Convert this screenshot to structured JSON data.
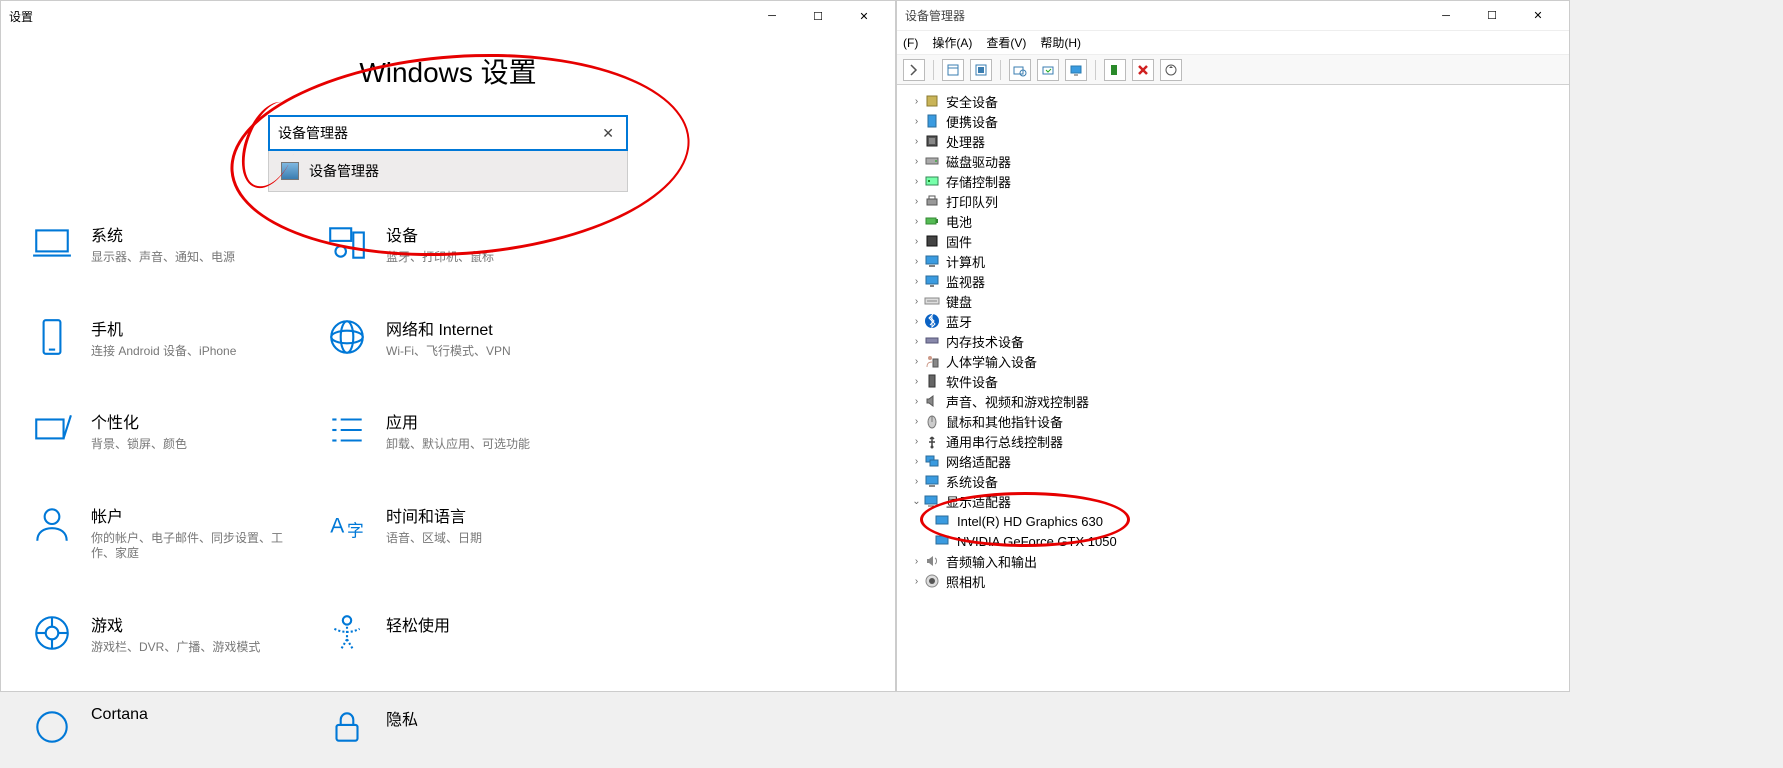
{
  "settings": {
    "window_title": "设置",
    "heading": "Windows 设置",
    "search_value": "设备管理器",
    "suggestion": "设备管理器",
    "categories": [
      {
        "title": "系统",
        "desc": "显示器、声音、通知、电源"
      },
      {
        "title": "设备",
        "desc": "蓝牙、打印机、鼠标"
      },
      {
        "title": "手机",
        "desc": "连接 Android 设备、iPhone"
      },
      {
        "title": "网络和 Internet",
        "desc": "Wi-Fi、飞行模式、VPN"
      },
      {
        "title": "个性化",
        "desc": "背景、锁屏、颜色"
      },
      {
        "title": "应用",
        "desc": "卸载、默认应用、可选功能"
      },
      {
        "title": "帐户",
        "desc": "你的帐户、电子邮件、同步设置、工作、家庭"
      },
      {
        "title": "时间和语言",
        "desc": "语音、区域、日期"
      },
      {
        "title": "游戏",
        "desc": "游戏栏、DVR、广播、游戏模式"
      },
      {
        "title": "轻松使用",
        "desc": ""
      },
      {
        "title": "Cortana",
        "desc": ""
      },
      {
        "title": "隐私",
        "desc": ""
      }
    ]
  },
  "device_manager": {
    "window_title": "设备管理器",
    "menus": {
      "file": "(F)",
      "action": "操作(A)",
      "view": "查看(V)",
      "help": "帮助(H)"
    },
    "nodes": [
      {
        "label": "安全设备",
        "icon": "security"
      },
      {
        "label": "便携设备",
        "icon": "portable"
      },
      {
        "label": "处理器",
        "icon": "cpu"
      },
      {
        "label": "磁盘驱动器",
        "icon": "disk"
      },
      {
        "label": "存储控制器",
        "icon": "storagectl"
      },
      {
        "label": "打印队列",
        "icon": "printer"
      },
      {
        "label": "电池",
        "icon": "battery"
      },
      {
        "label": "固件",
        "icon": "firmware"
      },
      {
        "label": "计算机",
        "icon": "computer"
      },
      {
        "label": "监视器",
        "icon": "monitor"
      },
      {
        "label": "键盘",
        "icon": "keyboard"
      },
      {
        "label": "蓝牙",
        "icon": "bluetooth"
      },
      {
        "label": "内存技术设备",
        "icon": "memory"
      },
      {
        "label": "人体学输入设备",
        "icon": "hid"
      },
      {
        "label": "软件设备",
        "icon": "software"
      },
      {
        "label": "声音、视频和游戏控制器",
        "icon": "audio"
      },
      {
        "label": "鼠标和其他指针设备",
        "icon": "mouse"
      },
      {
        "label": "通用串行总线控制器",
        "icon": "usb"
      },
      {
        "label": "网络适配器",
        "icon": "network"
      },
      {
        "label": "系统设备",
        "icon": "system"
      }
    ],
    "display_adapters_label": "显示适配器",
    "display_children": [
      "Intel(R) HD Graphics 630",
      "NVIDIA GeForce GTX 1050"
    ],
    "tail_nodes": [
      {
        "label": "音频输入和输出",
        "icon": "audioio"
      },
      {
        "label": "照相机",
        "icon": "camera"
      }
    ]
  }
}
